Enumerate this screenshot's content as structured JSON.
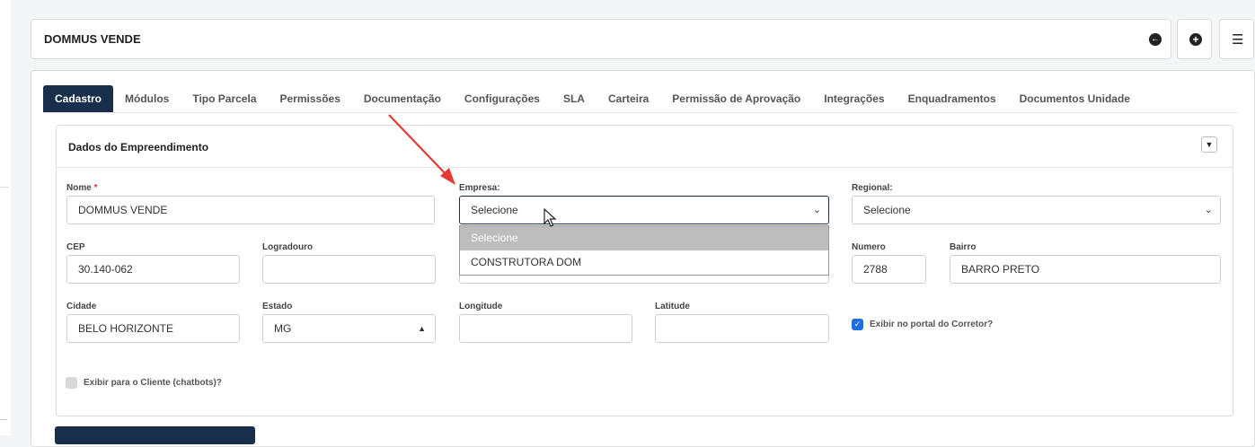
{
  "header": {
    "title": "DOMMUS VENDE"
  },
  "icons": {
    "back": "arrow-left-circle-icon",
    "add": "plus-circle-icon",
    "menu": "hamburger-menu-icon",
    "collapse": "chevron-down-icon"
  },
  "tabs": [
    {
      "label": "Cadastro",
      "active": true
    },
    {
      "label": "Módulos"
    },
    {
      "label": "Tipo Parcela"
    },
    {
      "label": "Permissões"
    },
    {
      "label": "Documentação"
    },
    {
      "label": "Configurações"
    },
    {
      "label": "SLA"
    },
    {
      "label": "Carteira"
    },
    {
      "label": "Permissão de Aprovação"
    },
    {
      "label": "Integrações"
    },
    {
      "label": "Enquadramentos"
    },
    {
      "label": "Documentos Unidade"
    }
  ],
  "section": {
    "title": "Dados do Empreendimento"
  },
  "form": {
    "nome": {
      "label": "Nome",
      "required": "*",
      "value": "DOMMUS VENDE"
    },
    "empresa": {
      "label": "Empresa:",
      "value": "Selecione",
      "options": [
        "Selecione",
        "CONSTRUTORA DOM"
      ]
    },
    "regional": {
      "label": "Regional:",
      "value": "Selecione"
    },
    "cep": {
      "label": "CEP",
      "value": "30.140-062"
    },
    "logradouro": {
      "label": "Logradouro",
      "value": ""
    },
    "numero": {
      "label": "Numero",
      "value": "2788"
    },
    "bairro": {
      "label": "Bairro",
      "value": "BARRO PRETO"
    },
    "cidade": {
      "label": "Cidade",
      "value": "BELO HORIZONTE"
    },
    "estado": {
      "label": "Estado",
      "value": "MG"
    },
    "longitude": {
      "label": "Longitude",
      "value": ""
    },
    "latitude": {
      "label": "Latitude",
      "value": ""
    },
    "exibir_corretor": {
      "label": "Exibir no portal do Corretor?",
      "checked": true
    },
    "exibir_cliente": {
      "label": "Exibir para o Cliente (chatbots)?",
      "checked": false
    }
  },
  "colors": {
    "primary": "#182e4b",
    "checkbox": "#1e6fe0",
    "annotation_arrow": "#e53935"
  }
}
